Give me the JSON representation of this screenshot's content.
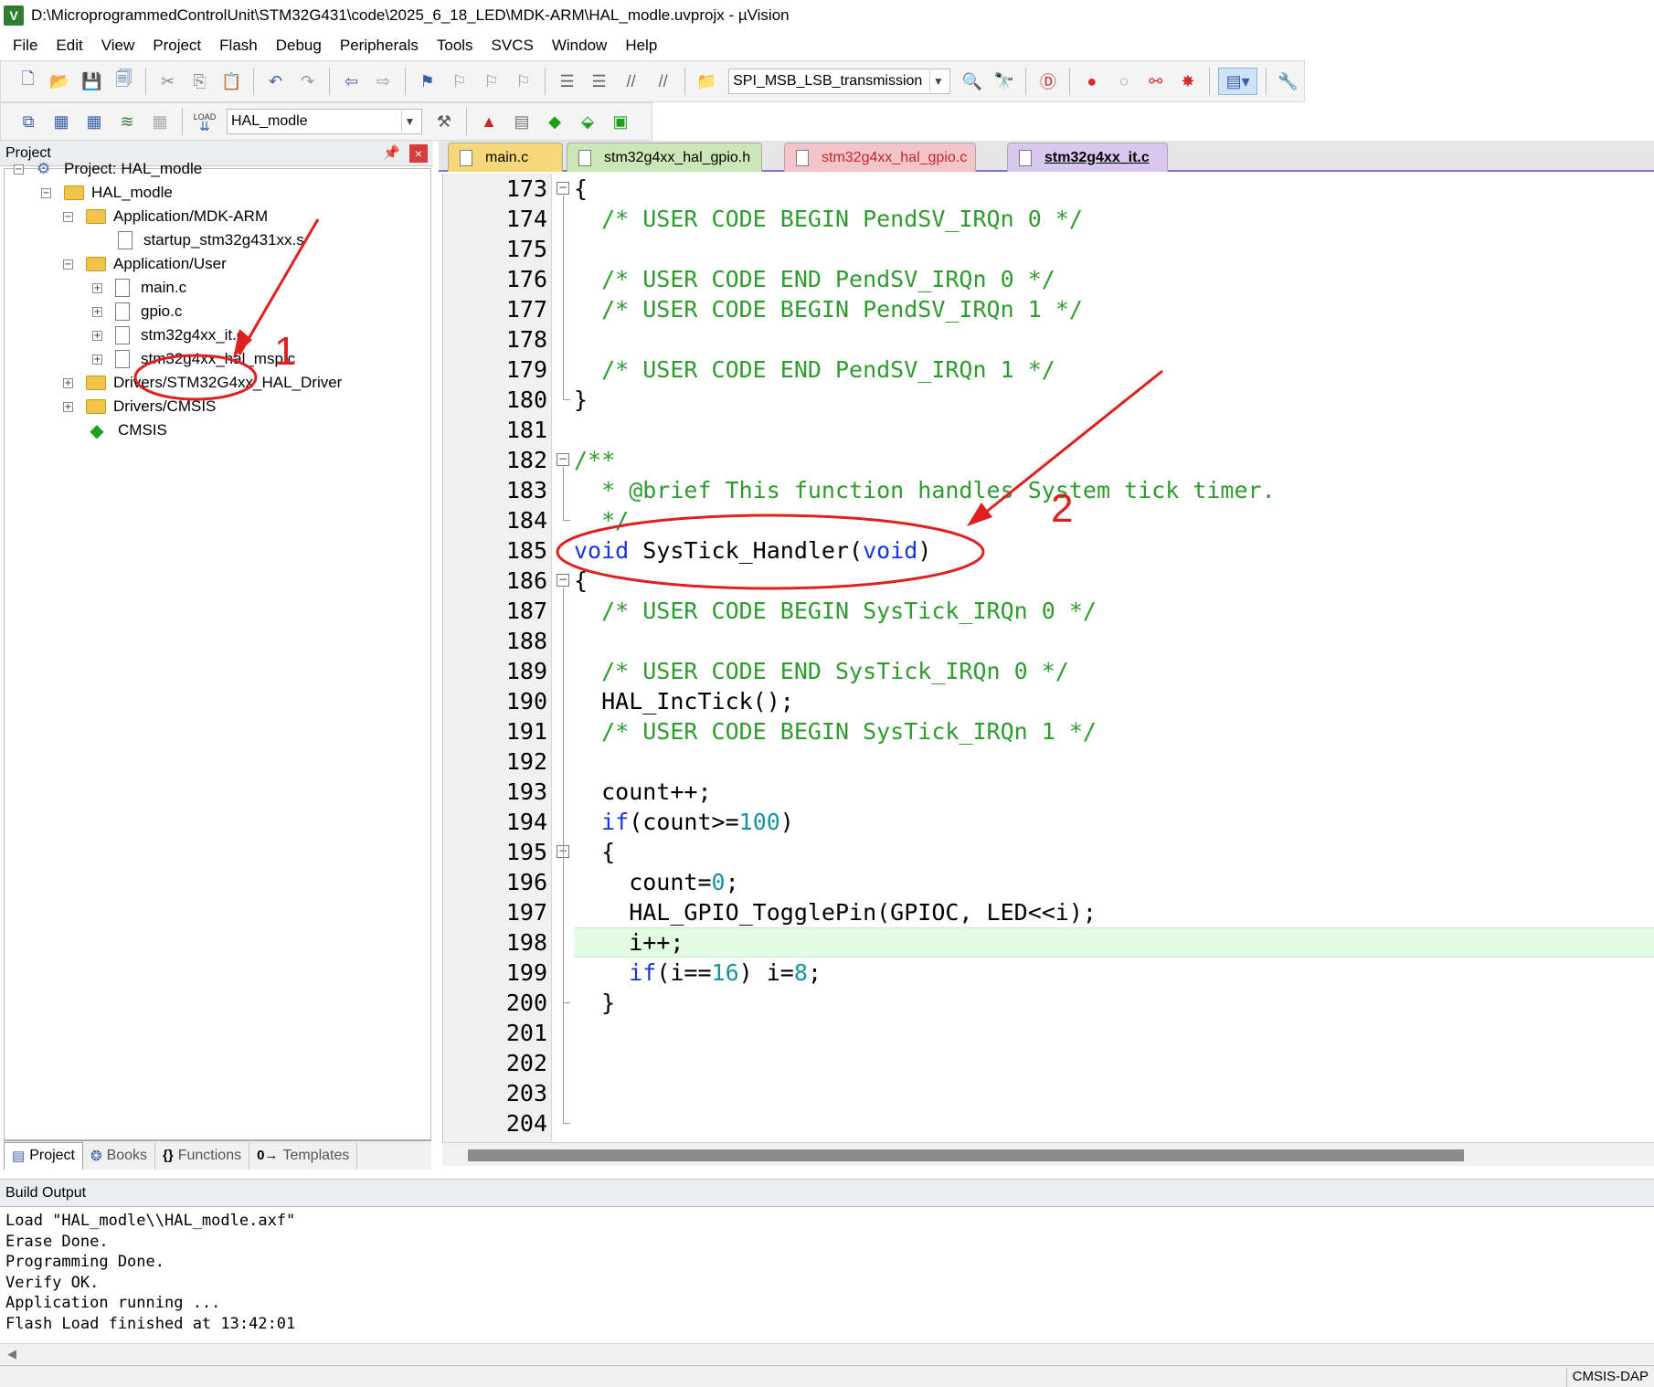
{
  "window": {
    "title": "D:\\MicroprogrammedControlUnit\\STM32G431\\code\\2025_6_18_LED\\MDK-ARM\\HAL_modle.uvprojx - µVision",
    "app_icon": "V"
  },
  "menu": [
    "File",
    "Edit",
    "View",
    "Project",
    "Flash",
    "Debug",
    "Peripherals",
    "Tools",
    "SVCS",
    "Window",
    "Help"
  ],
  "toolbar": {
    "target_combo": "SPI_MSB_LSB_transmission",
    "project_combo": "HAL_modle",
    "load_icon_text": "LOAD"
  },
  "project_panel": {
    "title": "Project",
    "close_glyph": "×",
    "tree": {
      "project": "Project: HAL_modle",
      "target": "HAL_modle",
      "group_mdk": "Application/MDK-ARM",
      "startup_file": "startup_stm32g431xx.s",
      "group_user": "Application/User",
      "file_main": "main.c",
      "file_gpio": "gpio.c",
      "file_it": "stm32g4xx_it.c",
      "file_msp": "stm32g4xx_hal_msp.c",
      "group_driver": "Drivers/STM32G4xx_HAL_Driver",
      "group_cmsis": "Drivers/CMSIS",
      "cmsis": "CMSIS"
    },
    "tabs": [
      {
        "label": "Project",
        "icon": "{}"
      },
      {
        "label": "Books",
        "icon": "{}"
      },
      {
        "label": "Functions",
        "icon": "{}"
      },
      {
        "label": "Templates",
        "icon": "0→"
      }
    ]
  },
  "editor": {
    "tabs": [
      "main.c",
      "stm32g4xx_hal_gpio.h",
      "stm32g4xx_hal_gpio.c",
      "stm32g4xx_it.c"
    ],
    "active_tab": "stm32g4xx_it.c",
    "lines": [
      {
        "n": "173",
        "parts": [
          [
            "t",
            "{"
          ]
        ]
      },
      {
        "n": "174",
        "parts": [
          [
            "c",
            "  /* USER CODE BEGIN PendSV_IRQn 0 */"
          ]
        ]
      },
      {
        "n": "175",
        "parts": []
      },
      {
        "n": "176",
        "parts": [
          [
            "c",
            "  /* USER CODE END PendSV_IRQn 0 */"
          ]
        ]
      },
      {
        "n": "177",
        "parts": [
          [
            "c",
            "  /* USER CODE BEGIN PendSV_IRQn 1 */"
          ]
        ]
      },
      {
        "n": "178",
        "parts": []
      },
      {
        "n": "179",
        "parts": [
          [
            "c",
            "  /* USER CODE END PendSV_IRQn 1 */"
          ]
        ]
      },
      {
        "n": "180",
        "parts": [
          [
            "t",
            "}"
          ]
        ]
      },
      {
        "n": "181",
        "parts": []
      },
      {
        "n": "182",
        "parts": [
          [
            "c",
            "/**"
          ]
        ]
      },
      {
        "n": "183",
        "parts": [
          [
            "c",
            "  * @brief This function handles System tick timer."
          ]
        ]
      },
      {
        "n": "184",
        "parts": [
          [
            "c",
            "  */"
          ]
        ]
      },
      {
        "n": "185",
        "parts": [
          [
            "k",
            "void"
          ],
          [
            "t",
            " SysTick_Handler("
          ],
          [
            "k",
            "void"
          ],
          [
            "t",
            ")"
          ]
        ]
      },
      {
        "n": "186",
        "parts": [
          [
            "t",
            "{"
          ]
        ]
      },
      {
        "n": "187",
        "parts": [
          [
            "c",
            "  /* USER CODE BEGIN SysTick_IRQn 0 */"
          ]
        ]
      },
      {
        "n": "188",
        "parts": []
      },
      {
        "n": "189",
        "parts": [
          [
            "c",
            "  /* USER CODE END SysTick_IRQn 0 */"
          ]
        ]
      },
      {
        "n": "190",
        "parts": [
          [
            "t",
            "  HAL_IncTick();"
          ]
        ]
      },
      {
        "n": "191",
        "parts": [
          [
            "c",
            "  /* USER CODE BEGIN SysTick_IRQn 1 */"
          ]
        ]
      },
      {
        "n": "192",
        "parts": []
      },
      {
        "n": "193",
        "parts": [
          [
            "t",
            "  count++;"
          ]
        ]
      },
      {
        "n": "194",
        "parts": [
          [
            "t",
            "  "
          ],
          [
            "k",
            "if"
          ],
          [
            "t",
            "(count>="
          ],
          [
            "n",
            "100"
          ],
          [
            "t",
            ")"
          ]
        ]
      },
      {
        "n": "195",
        "parts": [
          [
            "t",
            "  {"
          ]
        ]
      },
      {
        "n": "196",
        "parts": [
          [
            "t",
            "    count="
          ],
          [
            "n",
            "0"
          ],
          [
            "t",
            ";"
          ]
        ]
      },
      {
        "n": "197",
        "parts": [
          [
            "t",
            "    HAL_GPIO_TogglePin(GPIOC, LED<<i);"
          ]
        ]
      },
      {
        "n": "198",
        "parts": [
          [
            "t",
            "    i++;"
          ]
        ]
      },
      {
        "n": "199",
        "parts": [
          [
            "t",
            "    "
          ],
          [
            "k",
            "if"
          ],
          [
            "t",
            "(i=="
          ],
          [
            "n",
            "16"
          ],
          [
            "t",
            ") i="
          ],
          [
            "n",
            "8"
          ],
          [
            "t",
            ";"
          ]
        ]
      },
      {
        "n": "200",
        "parts": [
          [
            "t",
            "  }"
          ]
        ]
      },
      {
        "n": "201",
        "parts": []
      },
      {
        "n": "202",
        "parts": []
      },
      {
        "n": "203",
        "parts": []
      },
      {
        "n": "204",
        "parts": []
      }
    ],
    "highlighted_line": "198"
  },
  "build_output": {
    "title": "Build Output",
    "text": "Load \"HAL_modle\\\\HAL_modle.axf\"\nErase Done.\nProgramming Done.\nVerify OK.\nApplication running ...\nFlash Load finished at 13:42:01"
  },
  "status": {
    "right": "CMSIS-DAP"
  },
  "annotations": {
    "label_1": "1",
    "label_2": "2",
    "color": "#e0201f"
  },
  "colors": {
    "comment": "#2e9b2e",
    "keyword": "#1a35d6",
    "number": "#17939b",
    "highlight_line": "#e2fbe2",
    "active_tab": "#d8c7ef"
  }
}
